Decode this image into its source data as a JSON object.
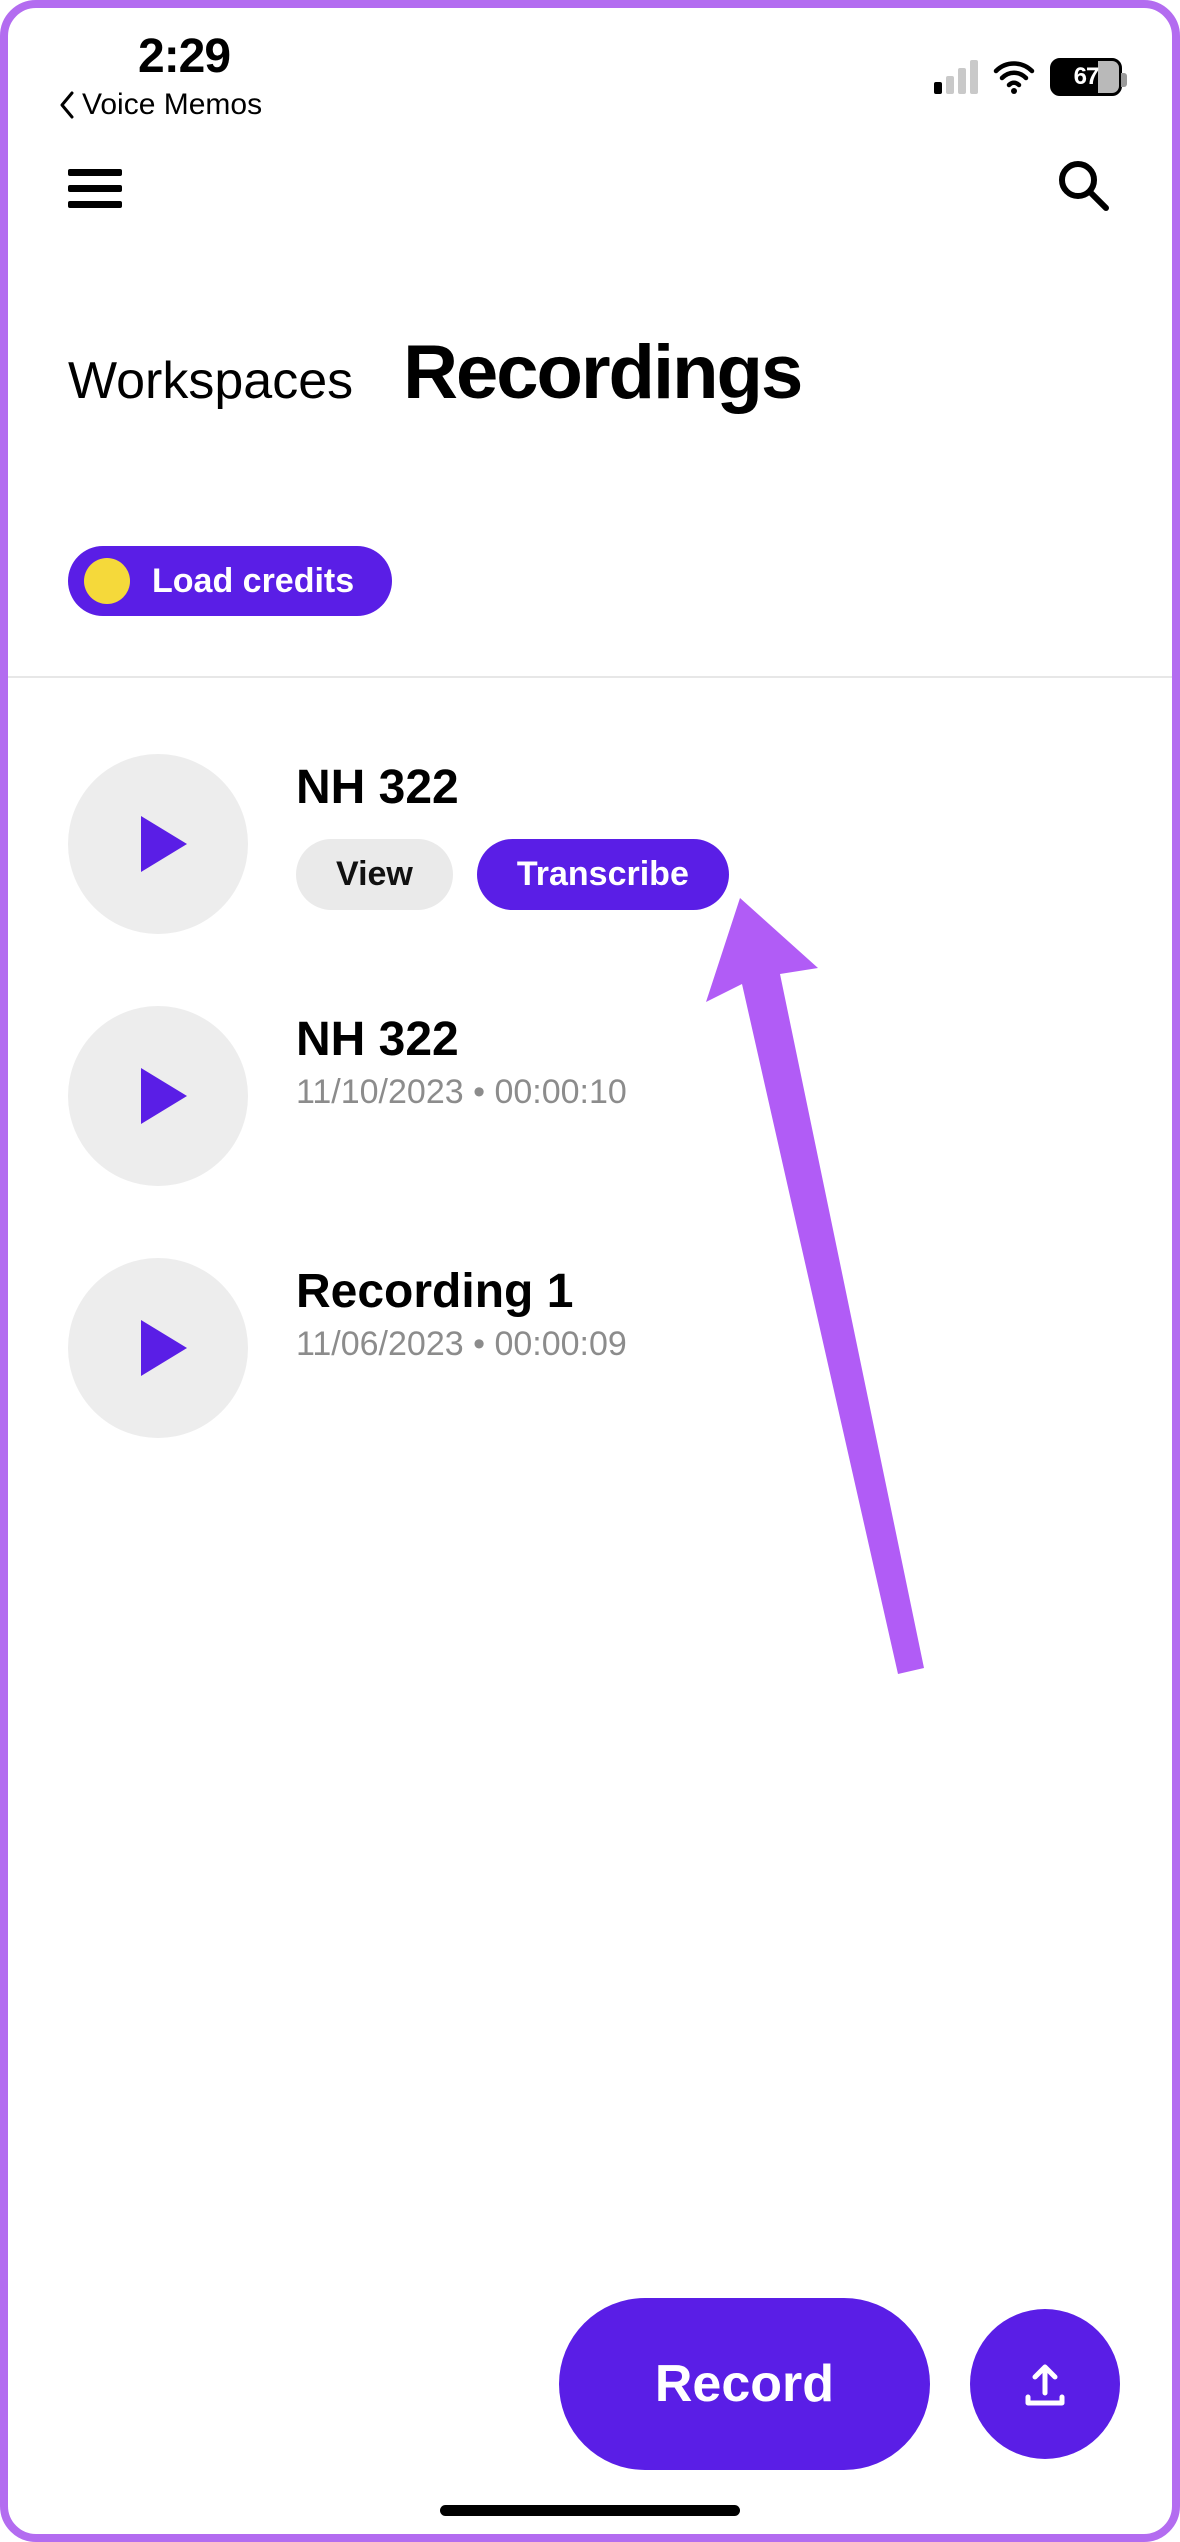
{
  "status": {
    "time": "2:29",
    "back_app_label": "Voice Memos",
    "battery_percent": "67"
  },
  "header": {
    "breadcrumb": "Workspaces",
    "title": "Recordings"
  },
  "credits": {
    "label": "Load credits"
  },
  "recordings": [
    {
      "title": "NH 322",
      "date": "",
      "duration": "",
      "expanded": true
    },
    {
      "title": "NH 322",
      "date": "11/10/2023",
      "duration": "00:00:10",
      "expanded": false
    },
    {
      "title": "Recording 1",
      "date": "11/06/2023",
      "duration": "00:00:09",
      "expanded": false
    }
  ],
  "rec_actions": {
    "view": "View",
    "transcribe": "Transcribe"
  },
  "bottom": {
    "record_label": "Record"
  },
  "colors": {
    "accent": "#5a1ee6",
    "frame": "#b36cf0",
    "coin": "#f5d93a"
  }
}
